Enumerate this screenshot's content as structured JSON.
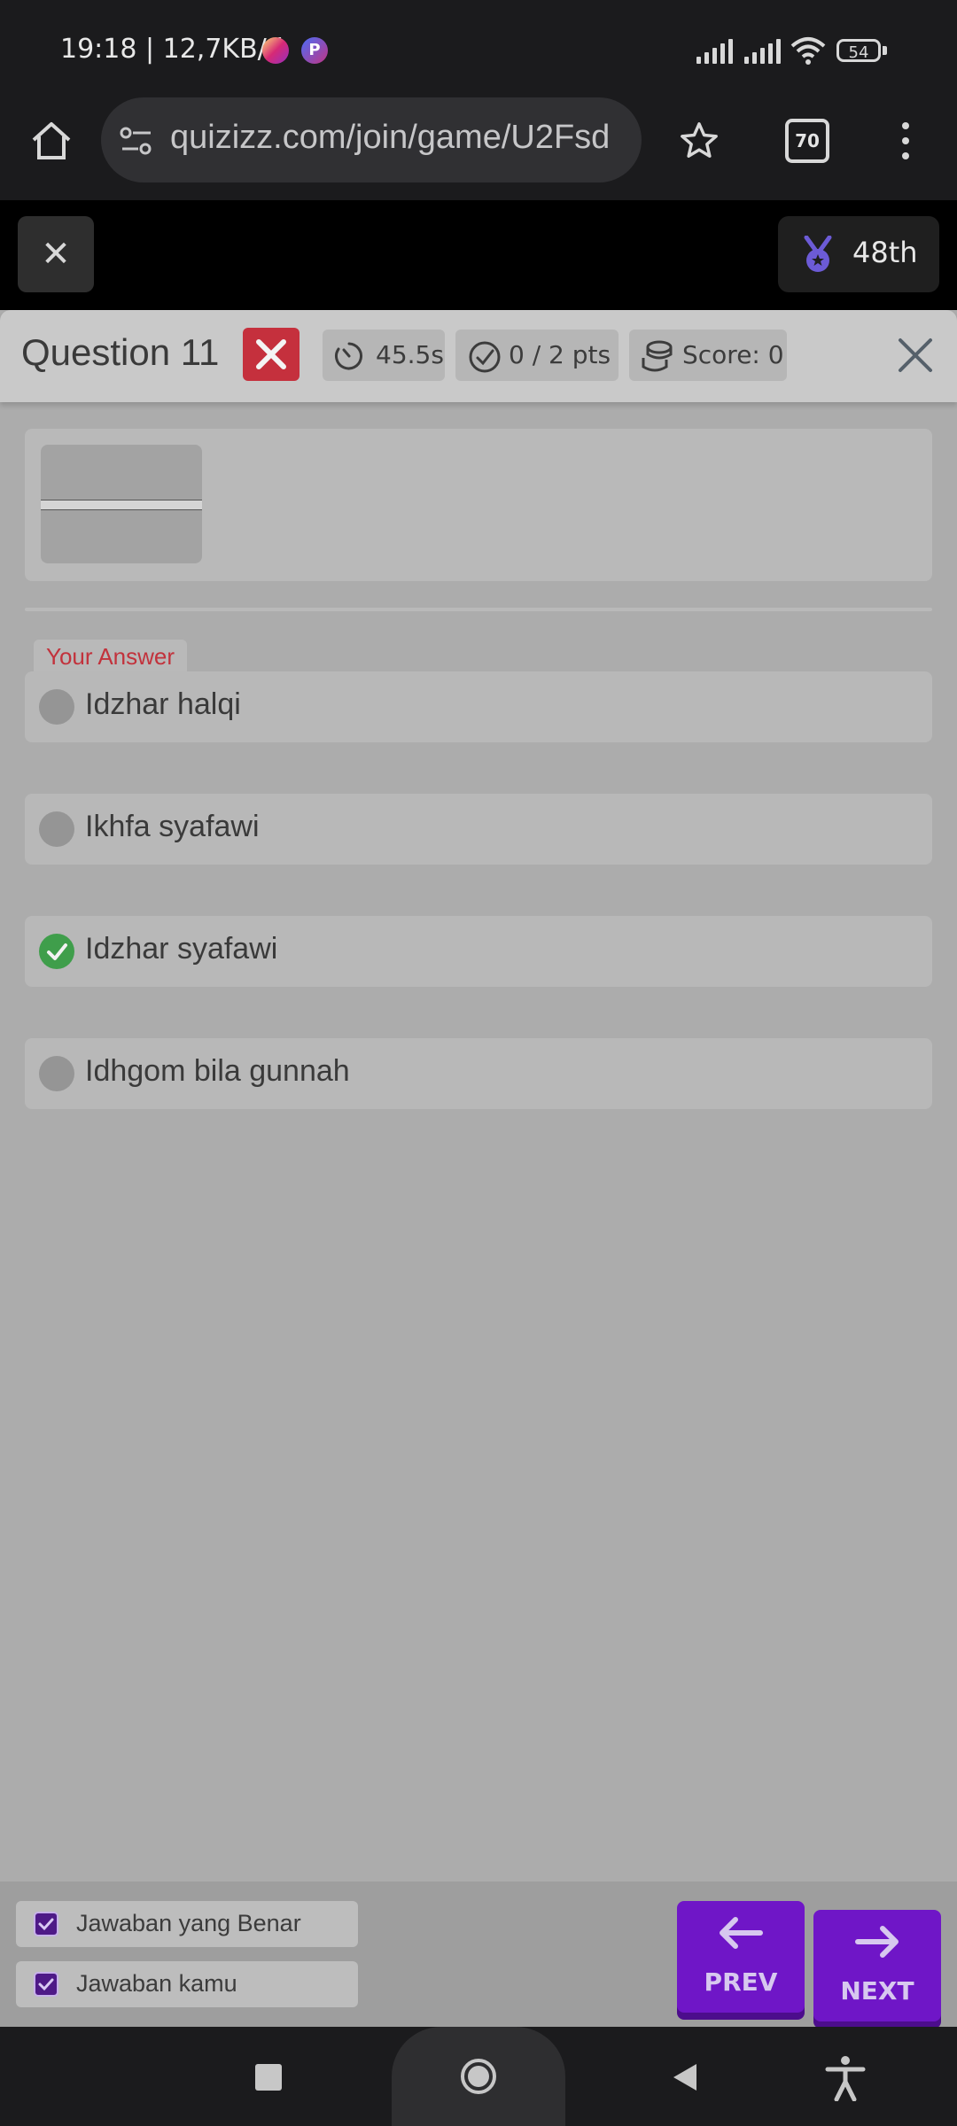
{
  "status_bar": {
    "time_speed": "19:18 | 12,7KB/d",
    "battery": "54",
    "notification_icons": [
      "instagram-icon",
      "p-app-icon"
    ]
  },
  "browser": {
    "url": "quizizz.com/join/game/U2Fsd",
    "tab_count": "70"
  },
  "game": {
    "exit_symbol": "✕",
    "rank": "48th"
  },
  "question_header": {
    "title": "Question 11",
    "time": "45.5s",
    "points": "0 / 2 pts",
    "score": "Score: 0"
  },
  "answers": {
    "your_answer_label": "Your Answer",
    "options": [
      {
        "label": "Idzhar halqi",
        "state": "your-answer"
      },
      {
        "label": "Ikhfa syafawi",
        "state": "neutral"
      },
      {
        "label": "Idzhar syafawi",
        "state": "correct"
      },
      {
        "label": "Idhgom bila gunnah",
        "state": "neutral"
      }
    ]
  },
  "legend": {
    "correct_label": "Jawaban yang Benar",
    "yours_label": "Jawaban kamu"
  },
  "navigation": {
    "prev_label": "PREV",
    "next_label": "NEXT"
  },
  "colors": {
    "wrong": "#c5303d",
    "correct": "#3f9e4b",
    "nav_button": "#6f16c7"
  }
}
